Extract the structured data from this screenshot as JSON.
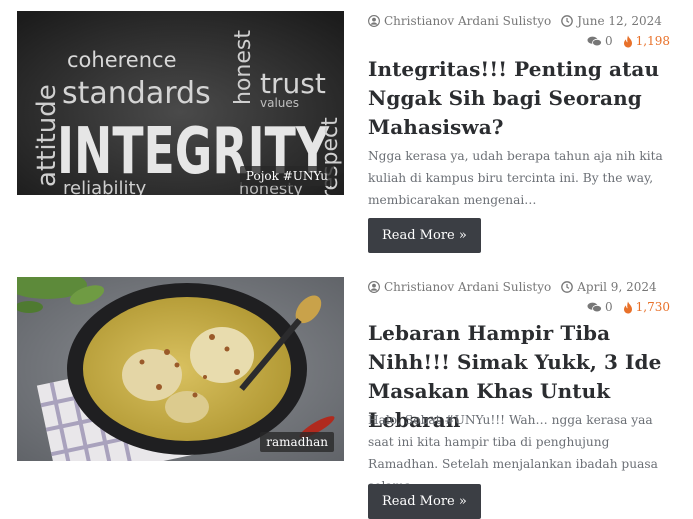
{
  "posts": [
    {
      "image_words": [
        "coherence",
        "standards",
        "trust",
        "values",
        "honest",
        "attitude",
        "INTEGRITY",
        "respect",
        "reliability",
        "honesty"
      ],
      "category": "Pojok #UNYu",
      "author": "Christianov Ardani Sulistyo",
      "date": "June 12, 2024",
      "comments": "0",
      "views": "1,198",
      "title": "Integritas!!! Penting atau Nggak Sih bagi Seorang Mahasiswa?",
      "excerpt": "Ngga kerasa ya, udah berapa tahun aja nih kita kuliah di kampus biru tercinta ini. By the way, membicarakan mengenai…",
      "button": "Read More »"
    },
    {
      "category": "ramadhan",
      "author": "Christianov Ardani Sulistyo",
      "date": "April 9, 2024",
      "comments": "0",
      "views": "1,730",
      "title": "Lebaran Hampir Tiba Nihh!!! Simak Yukk, 3 Ide Masakan Khas Untuk Lebaran",
      "excerpt": "Halo, Sobat #UNYu!!! Wah… ngga kerasa yaa saat ini kita hampir tiba di penghujung Ramadhan. Setelah menjalankan ibadah puasa selama…",
      "button": "Read More »"
    }
  ],
  "colors": {
    "views": "#e8712a",
    "button_bg": "#3b3e44",
    "meta": "#777777"
  },
  "icons": {
    "author": "user-icon",
    "date": "clock-icon",
    "comments": "comments-icon",
    "views": "fire-icon"
  }
}
